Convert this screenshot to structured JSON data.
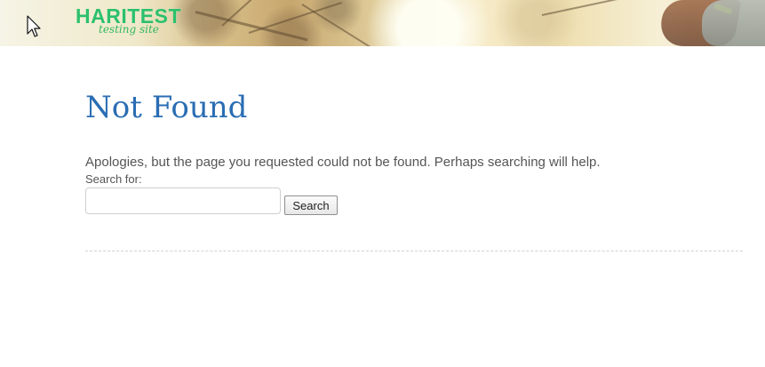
{
  "header": {
    "logo_main": "HARITEST",
    "logo_subtitle": "testing site",
    "accent_color": "#2cc06b"
  },
  "content": {
    "title": "Not Found",
    "message": "Apologies, but the page you requested could not be found. Perhaps searching will help.",
    "search": {
      "label": "Search for:",
      "value": "",
      "placeholder": "",
      "button_label": "Search"
    }
  },
  "icons": {
    "cursor": "mouse-cursor-icon"
  }
}
